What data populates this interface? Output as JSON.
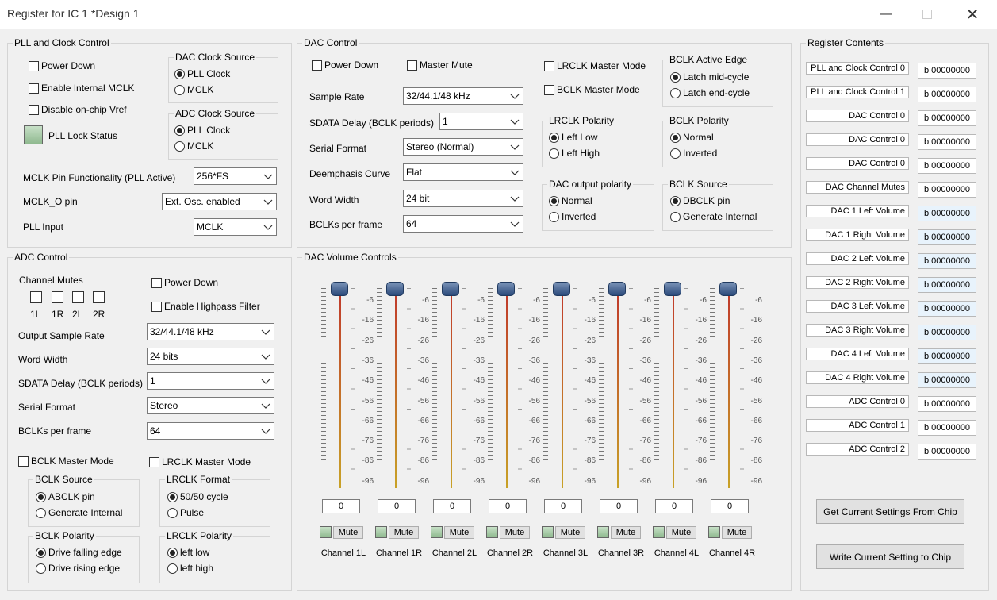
{
  "window": {
    "title": "Register for IC 1 *Design 1"
  },
  "pll": {
    "legend": "PLL and Clock Control",
    "power_down": "Power Down",
    "enable_internal_mclk": "Enable Internal MCLK",
    "disable_vref": "Disable on-chip Vref",
    "pll_lock_status": "PLL Lock Status",
    "dac_clock_source": {
      "legend": "DAC Clock Source",
      "opt1": "PLL Clock",
      "opt2": "MCLK"
    },
    "adc_clock_source": {
      "legend": "ADC Clock Source",
      "opt1": "PLL Clock",
      "opt2": "MCLK"
    },
    "mclk_pin_label": "MCLK Pin Functionality (PLL Active)",
    "mclk_pin_value": "256*FS",
    "mclk_o_label": "MCLK_O pin",
    "mclk_o_value": "Ext. Osc. enabled",
    "pll_input_label": "PLL Input",
    "pll_input_value": "MCLK"
  },
  "dac": {
    "legend": "DAC Control",
    "power_down": "Power Down",
    "master_mute": "Master Mute",
    "lrclk_master": "LRCLK Master Mode",
    "bclk_master": "BCLK Master Mode",
    "sample_rate_label": "Sample Rate",
    "sample_rate_value": "32/44.1/48 kHz",
    "sdata_delay_label": "SDATA Delay (BCLK periods)",
    "sdata_delay_value": "1",
    "serial_format_label": "Serial Format",
    "serial_format_value": "Stereo (Normal)",
    "deemph_label": "Deemphasis Curve",
    "deemph_value": "Flat",
    "word_width_label": "Word Width",
    "word_width_value": "24 bit",
    "bclks_label": "BCLKs per frame",
    "bclks_value": "64",
    "bclk_edge": {
      "legend": "BCLK Active Edge",
      "opt1": "Latch mid-cycle",
      "opt2": "Latch end-cycle"
    },
    "lrclk_pol": {
      "legend": "LRCLK Polarity",
      "opt1": "Left Low",
      "opt2": "Left High"
    },
    "bclk_pol": {
      "legend": "BCLK Polarity",
      "opt1": "Normal",
      "opt2": "Inverted"
    },
    "out_pol": {
      "legend": "DAC output polarity",
      "opt1": "Normal",
      "opt2": "Inverted"
    },
    "bclk_src": {
      "legend": "BCLK Source",
      "opt1": "DBCLK pin",
      "opt2": "Generate Internal"
    }
  },
  "adc": {
    "legend": "ADC Control",
    "channel_mutes": "Channel Mutes",
    "mute_labels": [
      "1L",
      "1R",
      "2L",
      "2R"
    ],
    "power_down": "Power Down",
    "highpass": "Enable Highpass Filter",
    "out_sr_label": "Output Sample Rate",
    "out_sr_value": "32/44.1/48 kHz",
    "word_width_label": "Word Width",
    "word_width_value": "24 bits",
    "sdata_label": "SDATA Delay (BCLK periods)",
    "sdata_value": "1",
    "serial_label": "Serial Format",
    "serial_value": "Stereo",
    "bclks_label": "BCLKs per frame",
    "bclks_value": "64",
    "bclk_master": "BCLK Master Mode",
    "lrclk_master": "LRCLK Master Mode",
    "bclk_src": {
      "legend": "BCLK Source",
      "opt1": "ABCLK pin",
      "opt2": "Generate Internal"
    },
    "lrclk_fmt": {
      "legend": "LRCLK Format",
      "opt1": "50/50 cycle",
      "opt2": "Pulse"
    },
    "bclk_pol": {
      "legend": "BCLK Polarity",
      "opt1": "Drive falling edge",
      "opt2": "Drive rising edge"
    },
    "lrclk_pol": {
      "legend": "LRCLK Polarity",
      "opt1": "left low",
      "opt2": "left high"
    }
  },
  "volume": {
    "legend": "DAC Volume Controls",
    "tick_labels": [
      "-6",
      "-16",
      "-26",
      "-36",
      "-46",
      "-56",
      "-66",
      "-76",
      "-86",
      "-96"
    ],
    "mute_label": "Mute",
    "channels": [
      {
        "name": "Channel 1L",
        "value": "0"
      },
      {
        "name": "Channel 1R",
        "value": "0"
      },
      {
        "name": "Channel 2L",
        "value": "0"
      },
      {
        "name": "Channel 2R",
        "value": "0"
      },
      {
        "name": "Channel 3L",
        "value": "0"
      },
      {
        "name": "Channel 3R",
        "value": "0"
      },
      {
        "name": "Channel 4L",
        "value": "0"
      },
      {
        "name": "Channel 4R",
        "value": "0"
      }
    ]
  },
  "registers": {
    "legend": "Register Contents",
    "rows": [
      {
        "name": "PLL and Clock Control 0",
        "value": "b 00000000"
      },
      {
        "name": "PLL and Clock Control 1",
        "value": "b 00000000"
      },
      {
        "name": "DAC Control 0",
        "value": "b 00000000"
      },
      {
        "name": "DAC Control 0",
        "value": "b 00000000"
      },
      {
        "name": "DAC Control 0",
        "value": "b 00000000"
      },
      {
        "name": "DAC Channel Mutes",
        "value": "b 00000000"
      },
      {
        "name": "DAC 1 Left Volume",
        "value": "b 00000000"
      },
      {
        "name": "DAC 1 Right Volume",
        "value": "b 00000000"
      },
      {
        "name": "DAC 2 Left Volume",
        "value": "b 00000000"
      },
      {
        "name": "DAC 2 Right Volume",
        "value": "b 00000000"
      },
      {
        "name": "DAC 3 Left Volume",
        "value": "b 00000000"
      },
      {
        "name": "DAC 3 Right Volume",
        "value": "b 00000000"
      },
      {
        "name": "DAC 4 Left Volume",
        "value": "b 00000000"
      },
      {
        "name": "DAC 4 Right Volume",
        "value": "b 00000000"
      },
      {
        "name": "ADC Control 0",
        "value": "b 00000000"
      },
      {
        "name": "ADC Control 1",
        "value": "b 00000000"
      },
      {
        "name": "ADC Control 2",
        "value": "b 00000000"
      }
    ],
    "get_button": "Get Current Settings From Chip",
    "write_button": "Write Current Setting to Chip"
  }
}
